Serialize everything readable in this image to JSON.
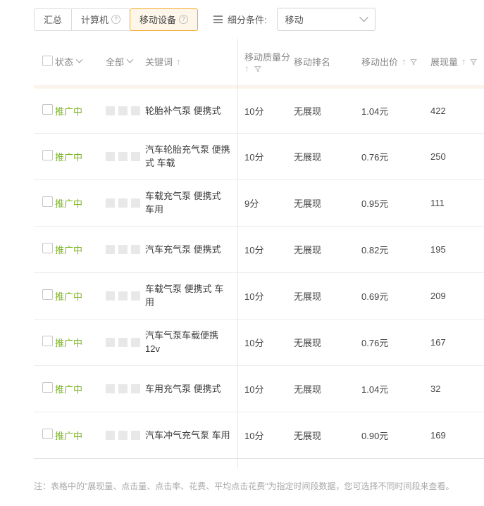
{
  "toolbar": {
    "tabs": [
      {
        "label": "汇总",
        "has_help": false,
        "active": false
      },
      {
        "label": "计算机",
        "has_help": true,
        "active": false
      },
      {
        "label": "移动设备",
        "has_help": true,
        "active": true
      }
    ],
    "segment_label": "细分条件:",
    "segment_select_value": "移动",
    "icons": {
      "help": "?",
      "list": "list-icon",
      "chevron": "chevron-down-icon"
    }
  },
  "table": {
    "headers": {
      "status": "状态",
      "all": "全部",
      "keyword": "关键词",
      "quality": "移动质量分",
      "rank": "移动排名",
      "bid": "移动出价",
      "impressions": "展现量"
    },
    "rows": [
      {
        "status": "推广中",
        "keyword": "轮胎补气泵 便携式",
        "quality": "10分",
        "rank": "无展现",
        "bid": "1.04元",
        "impressions": "422"
      },
      {
        "status": "推广中",
        "keyword": "汽车轮胎充气泵 便携式 车载",
        "quality": "10分",
        "rank": "无展现",
        "bid": "0.76元",
        "impressions": "250"
      },
      {
        "status": "推广中",
        "keyword": "车载充气泵 便携式 车用",
        "quality": "9分",
        "rank": "无展现",
        "bid": "0.95元",
        "impressions": "111"
      },
      {
        "status": "推广中",
        "keyword": "汽车充气泵 便携式",
        "quality": "10分",
        "rank": "无展现",
        "bid": "0.82元",
        "impressions": "195"
      },
      {
        "status": "推广中",
        "keyword": "车载气泵 便携式 车用",
        "quality": "10分",
        "rank": "无展现",
        "bid": "0.69元",
        "impressions": "209"
      },
      {
        "status": "推广中",
        "keyword": "汽车气泵车载便携 12v",
        "quality": "10分",
        "rank": "无展现",
        "bid": "0.76元",
        "impressions": "167"
      },
      {
        "status": "推广中",
        "keyword": "车用充气泵 便携式",
        "quality": "10分",
        "rank": "无展现",
        "bid": "1.04元",
        "impressions": "32"
      },
      {
        "status": "推广中",
        "keyword": "汽车冲气充气泵 车用",
        "quality": "10分",
        "rank": "无展现",
        "bid": "0.90元",
        "impressions": "169"
      }
    ]
  },
  "footer": {
    "note": "注：表格中的\"展现量、点击量、点击率、花费、平均点击花费\"为指定时间段数据，您可选择不同时间段来查看。"
  },
  "colors": {
    "accent_orange": "#f5a623",
    "active_tab_bg": "#fdf6e9",
    "status_green": "#7ab51d",
    "header_strip": "#fbf4ec"
  }
}
